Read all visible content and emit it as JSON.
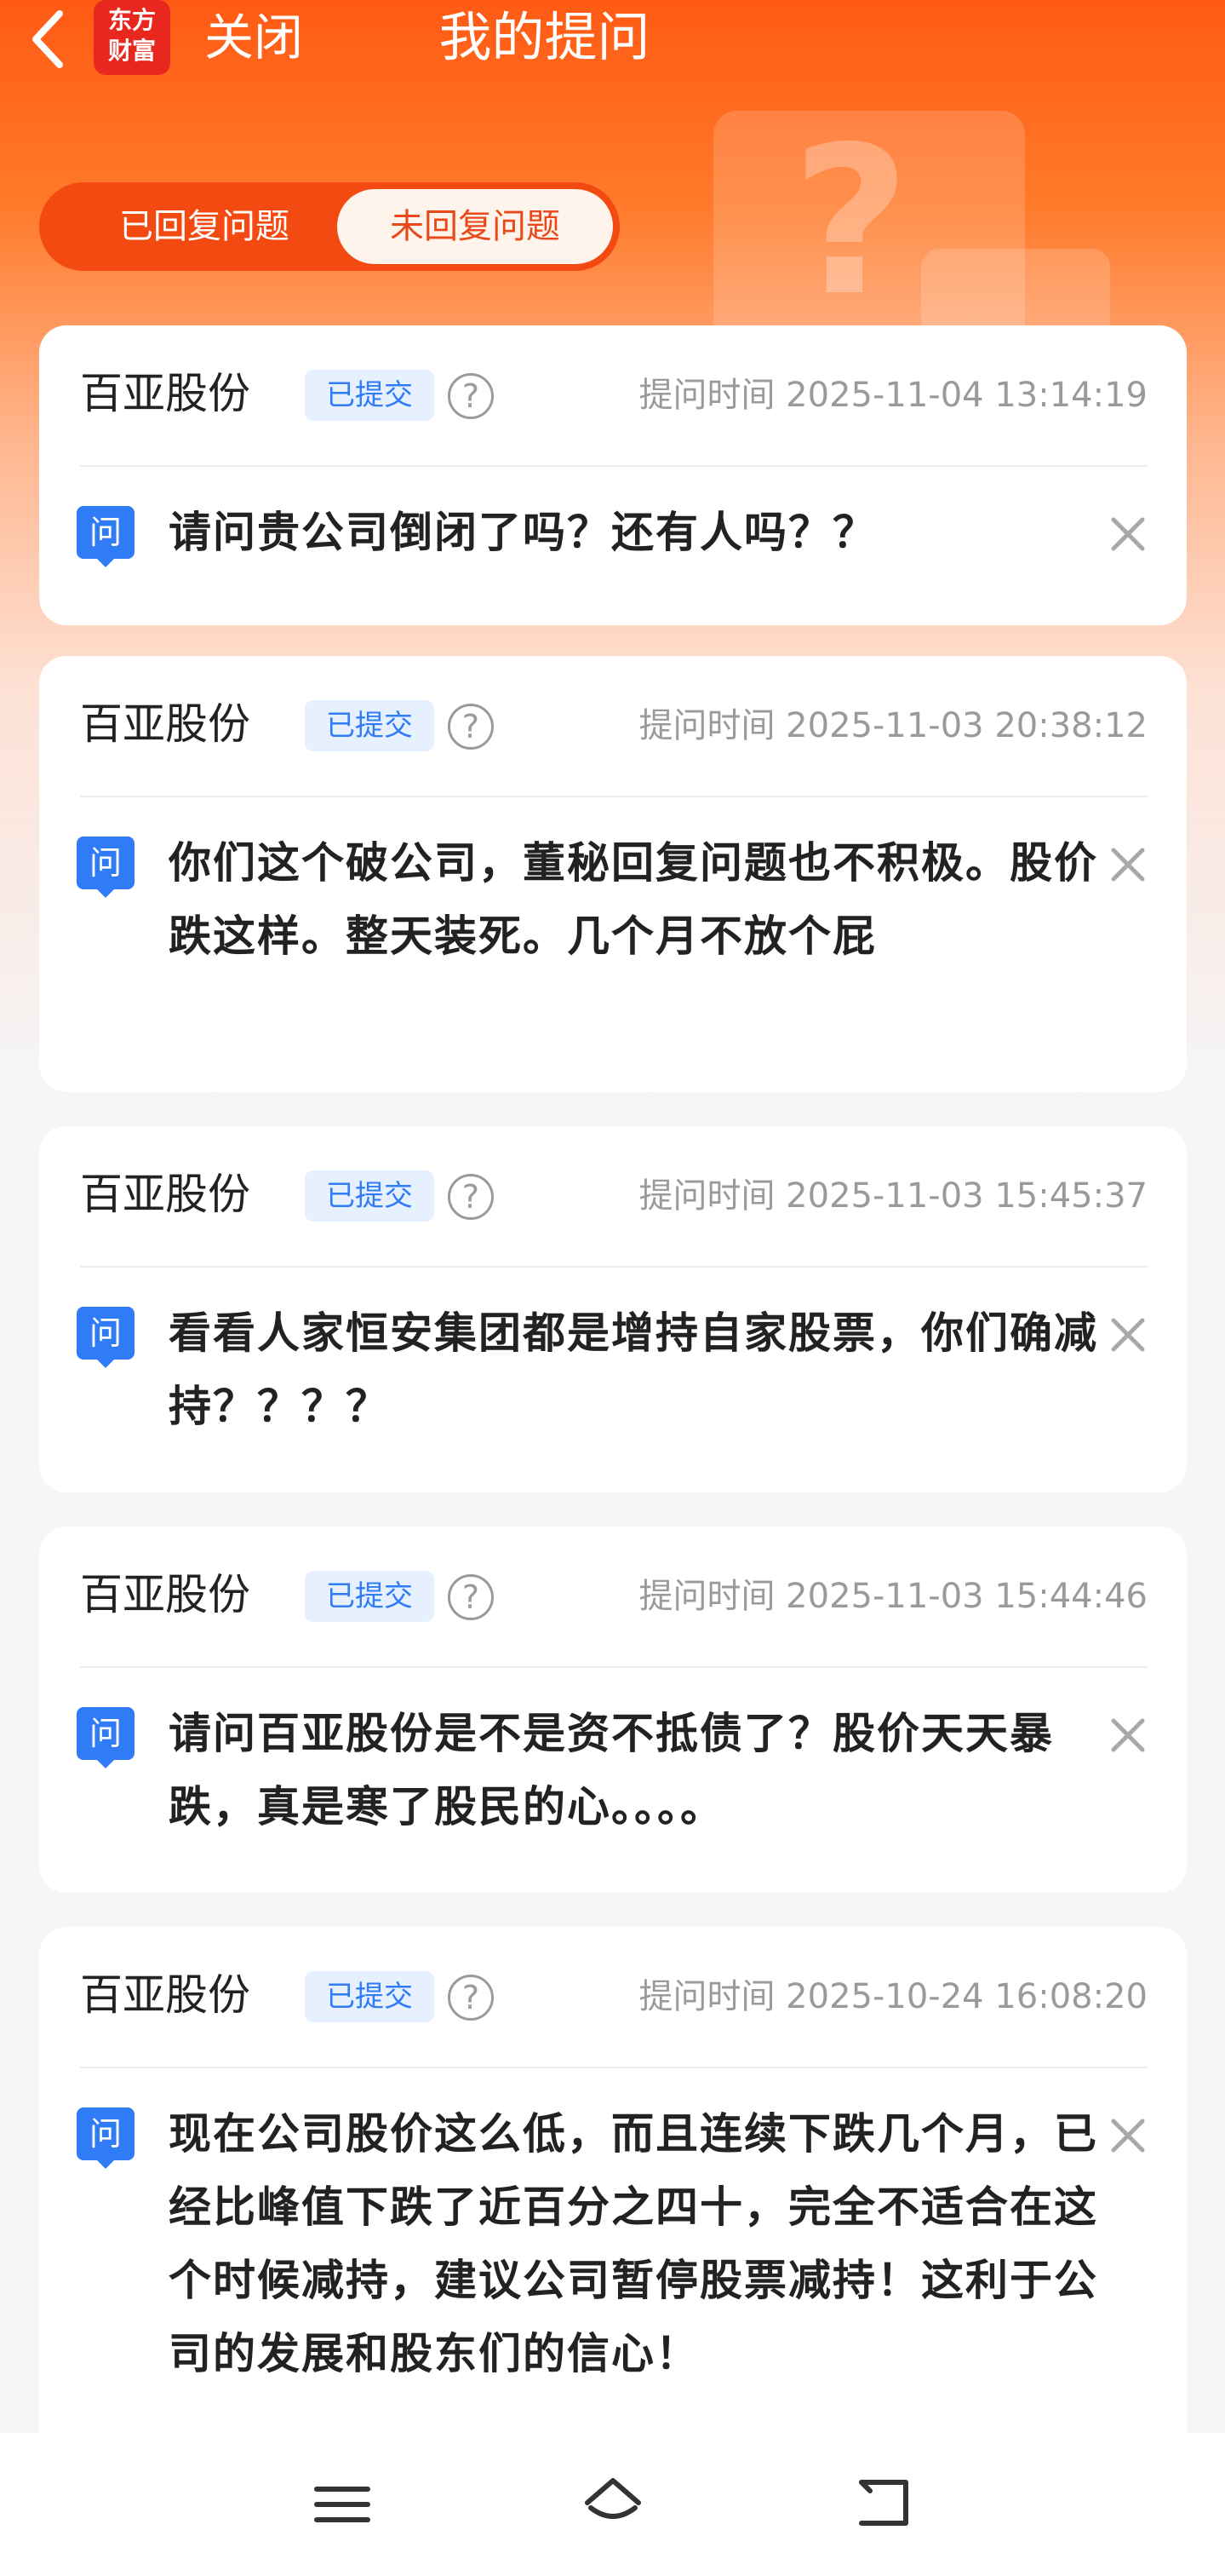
{
  "header": {
    "logo_line1": "东方",
    "logo_line2": "财富",
    "close_label": "关闭",
    "title": "我的提问"
  },
  "tabs": [
    {
      "label": "已回复问题",
      "selected": false
    },
    {
      "label": "未回复问题",
      "selected": true
    }
  ],
  "colors": {
    "brand_orange": "#ff5a14",
    "logo_red": "#e8281e",
    "badge_blue": "#2f7cf6"
  },
  "questions": [
    {
      "company": "百亚股份",
      "status": "已提交",
      "time": "提问时间 2025-11-04 13:14:19",
      "text": "请问贵公司倒闭了吗？还有人吗？？"
    },
    {
      "company": "百亚股份",
      "status": "已提交",
      "time": "提问时间 2025-11-03 20:38:12",
      "text": "你们这个破公司，董秘回复问题也不积极。股价跌这样。整天装死。几个月不放个屁"
    },
    {
      "company": "百亚股份",
      "status": "已提交",
      "time": "提问时间 2025-11-03 15:45:37",
      "text": "看看人家恒安集团都是增持自家股票，你们确减持？？？？"
    },
    {
      "company": "百亚股份",
      "status": "已提交",
      "time": "提问时间 2025-11-03 15:44:46",
      "text": "请问百亚股份是不是资不抵债了？股价天天暴跌，真是寒了股民的心。。。。"
    },
    {
      "company": "百亚股份",
      "status": "已提交",
      "time": "提问时间 2025-10-24 16:08:20",
      "text": "现在公司股价这么低，而且连续下跌几个月，已经比峰值下跌了近百分之四十，完全不适合在这个时候减持，建议公司暂停股票减持！这利于公司的发展和股东们的信心！"
    }
  ],
  "question_icon_label": "问",
  "icons": {
    "back": "back-arrow-icon",
    "help": "question-mark-icon",
    "dismiss": "close-icon",
    "nav_menu": "menu-icon",
    "nav_home": "home-icon",
    "nav_back": "back-icon"
  }
}
